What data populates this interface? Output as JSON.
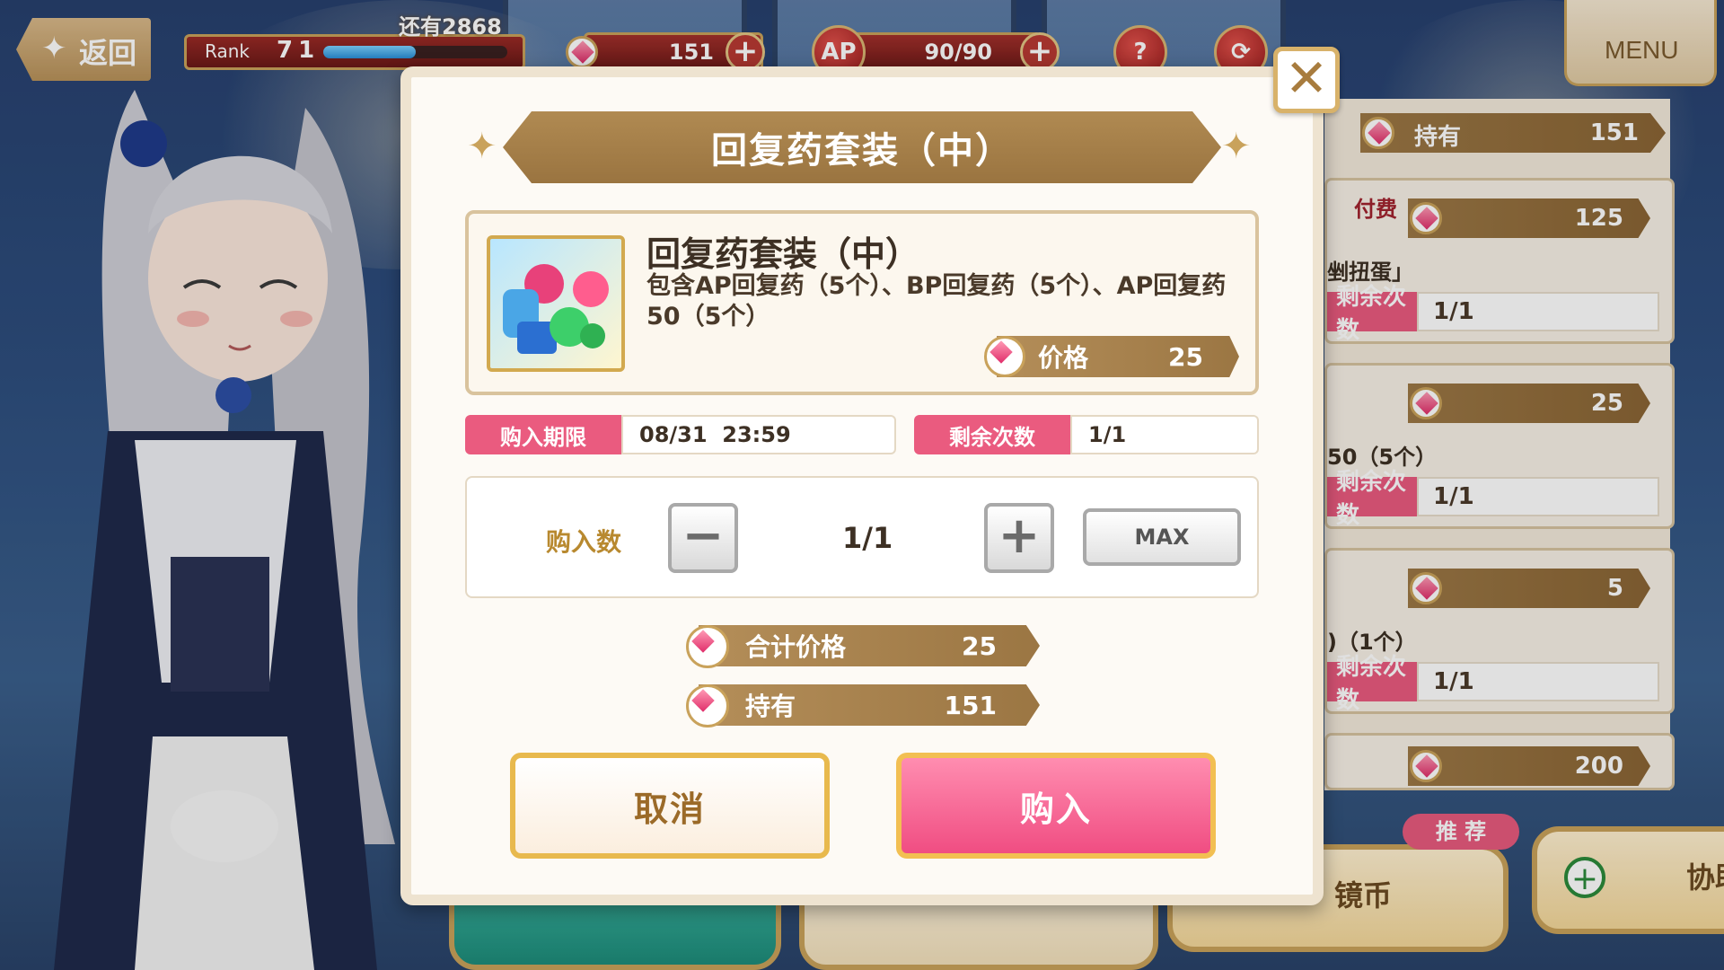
{
  "hud": {
    "back_label": "返回",
    "rank_label": "Rank",
    "rank_value": "71",
    "exp_remaining": "还有2868",
    "exp_progress": 0.5,
    "gems": "151",
    "ap_label": "AP",
    "ap_value": "90/90",
    "help_label": "?",
    "menu_label": "MENU"
  },
  "shop": {
    "owned_label": "持有",
    "owned_value": "151",
    "paid_tag": "付费",
    "cards": [
      {
        "price": "125",
        "desc": "剉扭蛋」",
        "remain_label": "剩余次数",
        "remain_value": "1/1"
      },
      {
        "price": "25",
        "desc": "50（5个）",
        "remain_label": "剩余次数",
        "remain_value": "1/1"
      },
      {
        "price": "5",
        "desc": ")（1个）",
        "remain_label": "剩余次数",
        "remain_value": "1/1"
      },
      {
        "price": "200"
      }
    ]
  },
  "bottom": {
    "recommend_tag": "推 荐",
    "mirror_coin_label": "镜币",
    "coop_label": "协助"
  },
  "modal": {
    "title": "回复药套装（中）",
    "item_name": "回复药套装（中）",
    "item_desc": "包含AP回复药（5个）、BP回复药（5个）、AP回复药50（5个）",
    "price_label": "价格",
    "price_value": "25",
    "deadline_label": "购入期限",
    "deadline_value": "08/31  23:59",
    "remain_label": "剩余次数",
    "remain_value": "1/1",
    "qty_label": "购入数",
    "qty_value": "1/1",
    "minus_label": "−",
    "plus_label": "+",
    "max_label": "MAX",
    "total_label": "合计价格",
    "total_value": "25",
    "owned_label": "持有",
    "owned_value": "151",
    "cancel_label": "取消",
    "buy_label": "购入",
    "close_label": "✕"
  },
  "colors": {
    "accent_pink": "#ea5b7f",
    "gold": "#c9a25b",
    "ribbon_brown": "#a3804b"
  }
}
